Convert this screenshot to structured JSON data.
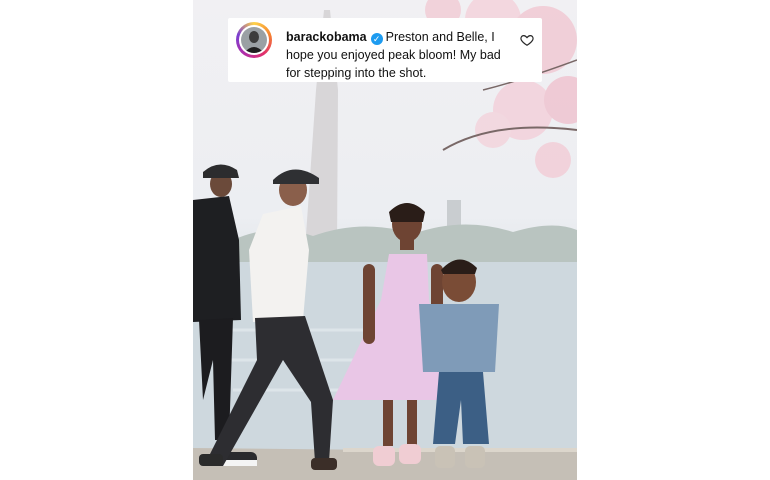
{
  "comment": {
    "username": "barackobama",
    "verified_icon": "verified-badge-icon",
    "text": "Preston and Belle, I hope you enjoyed peak bloom! My bad for stepping into the shot.",
    "like_icon": "heart-outline-icon"
  },
  "colors": {
    "verified": "#1d9bf0",
    "story_ring": [
      "#fdd24a",
      "#f6812f",
      "#e1306c",
      "#b12ea8"
    ],
    "dress": "#e9c6e6",
    "denim": "#7f9bb8"
  }
}
